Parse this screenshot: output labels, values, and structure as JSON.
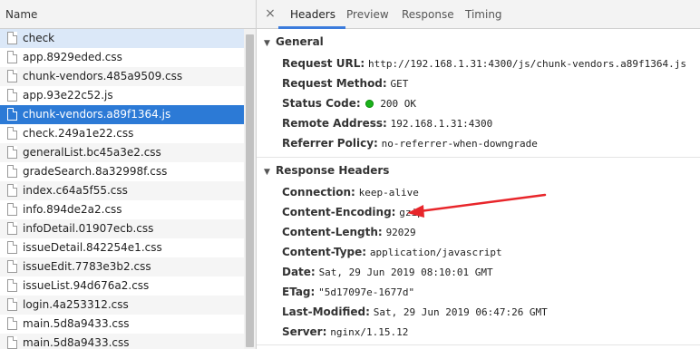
{
  "list": {
    "header": "Name",
    "items": [
      "check",
      "app.8929eded.css",
      "chunk-vendors.485a9509.css",
      "app.93e22c52.js",
      "chunk-vendors.a89f1364.js",
      "check.249a1e22.css",
      "generalList.bc45a3e2.css",
      "gradeSearch.8a32998f.css",
      "index.c64a5f55.css",
      "info.894de2a2.css",
      "infoDetail.01907ecb.css",
      "issueDetail.842254e1.css",
      "issueEdit.7783e3b2.css",
      "issueList.94d676a2.css",
      "login.4a253312.css",
      "main.5d8a9433.css",
      "main.5d8a9433.css"
    ]
  },
  "tabs": {
    "close": "×",
    "headers": "Headers",
    "preview": "Preview",
    "response": "Response",
    "timing": "Timing"
  },
  "general": {
    "title": "General",
    "request_url_label": "Request URL:",
    "request_url": "http://192.168.1.31:4300/js/chunk-vendors.a89f1364.js",
    "request_method_label": "Request Method:",
    "request_method": "GET",
    "status_code_label": "Status Code:",
    "status_code": "200 OK",
    "remote_address_label": "Remote Address:",
    "remote_address": "192.168.1.31:4300",
    "referrer_policy_label": "Referrer Policy:",
    "referrer_policy": "no-referrer-when-downgrade"
  },
  "response_headers": {
    "title": "Response Headers",
    "connection_label": "Connection:",
    "connection": "keep-alive",
    "content_encoding_label": "Content-Encoding:",
    "content_encoding": "gzip",
    "content_length_label": "Content-Length:",
    "content_length": "92029",
    "content_type_label": "Content-Type:",
    "content_type": "application/javascript",
    "date_label": "Date:",
    "date": "Sat, 29 Jun 2019 08:10:01 GMT",
    "etag_label": "ETag:",
    "etag": "\"5d17097e-1677d\"",
    "last_modified_label": "Last-Modified:",
    "last_modified": "Sat, 29 Jun 2019 06:47:26 GMT",
    "server_label": "Server:",
    "server": "nginx/1.15.12"
  },
  "colors": {
    "selected_row": "#2c7ad6",
    "highlighted_row": "#dbe8f8",
    "status_ok": "#1bb21b",
    "annotation_arrow": "#e8262b",
    "active_tab_underline": "#3b7bdc"
  }
}
